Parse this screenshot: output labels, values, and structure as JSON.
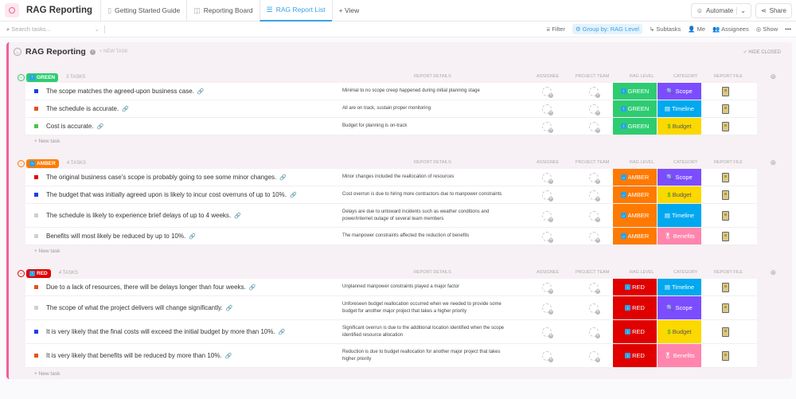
{
  "app": {
    "title": "RAG Reporting"
  },
  "tabs": [
    {
      "label": "Getting Started Guide",
      "icon": "doc-icon"
    },
    {
      "label": "Reporting Board",
      "icon": "board-icon"
    },
    {
      "label": "RAG Report List",
      "icon": "list-icon",
      "active": true
    },
    {
      "label": "+ View"
    }
  ],
  "header": {
    "automate": "Automate",
    "share": "Share"
  },
  "toolbar": {
    "search_placeholder": "Search tasks...",
    "filter": "Filter",
    "group_by": "Group by: RAG Level",
    "subtasks": "Subtasks",
    "me": "Me",
    "assignees": "Assignees",
    "show": "Show"
  },
  "list": {
    "title": "RAG Reporting",
    "new_task": "+ NEW TASK",
    "hide_closed": "HIDE CLOSED",
    "add_task": "+ New task"
  },
  "columns": {
    "details": "REPORT DETAILS",
    "assignee": "ASSIGNEE",
    "team": "PROJECT TEAM",
    "rag": "RAG LEVEL",
    "category": "CATEGORY",
    "file": "REPORT FILE"
  },
  "colors": {
    "GREEN": "#2ecc71",
    "AMBER": "#ff7a00",
    "RED": "#e00000",
    "Scope": "#7b4dff",
    "Timeline": "#00a8f0",
    "Budget": "#fbd800",
    "Benefits": "#ff85ad"
  },
  "groups": [
    {
      "level": "GREEN",
      "arrow": "↑",
      "count": "3 TASKS",
      "tasks": [
        {
          "name": "The scope matches the agreed-upon business case.",
          "status_color": "#1a3cf0",
          "details": "Minimal to no scope creep happened during initial planning stage",
          "rag": "GREEN",
          "category": "Scope"
        },
        {
          "name": "The schedule is accurate.",
          "status_color": "#e8501a",
          "details": "All are on track, sustain proper monitoring",
          "rag": "GREEN",
          "category": "Timeline"
        },
        {
          "name": "Cost is accurate.",
          "status_color": "#4cc34c",
          "details": "Budget for planning is on-track",
          "rag": "GREEN",
          "category": "Budget"
        }
      ]
    },
    {
      "level": "AMBER",
      "arrow": "→",
      "count": "4 TASKS",
      "tasks": [
        {
          "name": "The original business case's scope is probably going to see some minor changes.",
          "status_color": "#e00000",
          "details": "Minor changes included the reallocation of resources",
          "rag": "AMBER",
          "category": "Scope"
        },
        {
          "name": "The budget that was initially agreed upon is likely to incur cost overruns of up to 10%.",
          "status_color": "#1a3cf0",
          "details": "Cost overrun is due to hiring more contractors due to manpower constraints",
          "rag": "AMBER",
          "category": "Budget"
        },
        {
          "name": "The schedule is likely to experience brief delays of up to 4 weeks.",
          "status_color": "#d0d0d0",
          "details": "Delays are due to untoward incidents such as weather conditions and power/internet outage of several team members",
          "rag": "AMBER",
          "category": "Timeline"
        },
        {
          "name": "Benefits will most likely be reduced by up to 10%.",
          "status_color": "#d0d0d0",
          "details": "The manpower constraints affected the reduction of benefits",
          "rag": "AMBER",
          "category": "Benefits"
        }
      ]
    },
    {
      "level": "RED",
      "arrow": "↓",
      "count": "4 TASKS",
      "tasks": [
        {
          "name": "Due to a lack of resources, there will be delays longer than four weeks.",
          "status_color": "#e8501a",
          "details": "Unplanned manpower constraints played a major factor",
          "rag": "RED",
          "category": "Timeline"
        },
        {
          "name": "The scope of what the project delivers will change significantly.",
          "status_color": "#d0d0d0",
          "details": "Unforeseen budget reallocation occurred when we needed to provide some budget for another major project that takes a higher priority",
          "rag": "RED",
          "category": "Scope"
        },
        {
          "name": "It is very likely that the final costs will exceed the initial budget by more than 10%.",
          "status_color": "#1a3cf0",
          "details": "Significant overrun is due to the additional location identified when the scope identified resource allocation",
          "rag": "RED",
          "category": "Budget"
        },
        {
          "name": "It is very likely that benefits will be reduced by more than 10%.",
          "status_color": "#e8501a",
          "details": "Reduction is due to budget reallocation for another major project that takes higher priority",
          "rag": "RED",
          "category": "Benefits"
        }
      ]
    }
  ]
}
